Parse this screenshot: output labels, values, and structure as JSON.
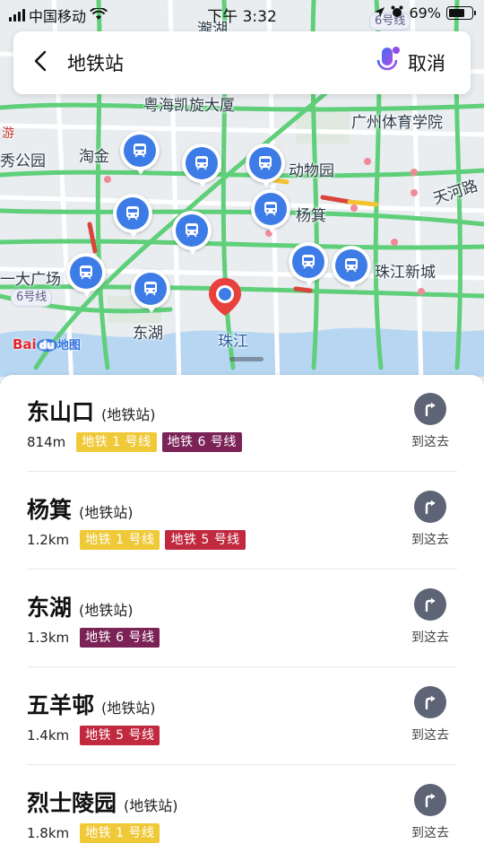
{
  "status_bar": {
    "carrier": "中国移动",
    "time": "下午 3:32",
    "battery": "69%",
    "battery_level": 0.69
  },
  "search": {
    "query": "地铁站",
    "cancel_label": "取消",
    "back_icon": "chevron-left-icon",
    "voice_icon": "microphone-icon"
  },
  "map": {
    "labels": {
      "shahe": "瀧湖",
      "yuehai": "粤海凯旋大厦",
      "sport_college": "广州体育学院",
      "taojin": "淘金",
      "zoo": "动物园",
      "tianhe_road": "天河路",
      "yangji": "杨箕",
      "zhujiang_newtown": "珠江新城",
      "yida_plaza": "一大广场",
      "donghu": "东湖",
      "zhujiang": "珠江",
      "xiu_park": "秀公园",
      "travel_tag": "游"
    },
    "line_tags": {
      "line6_top": "6号线",
      "line6_left": "6号线"
    },
    "logo": {
      "bai": "Bai",
      "du": "du",
      "map": "地图"
    },
    "colors": {
      "background": "#e9edf0",
      "road_major": "#5fcf7a",
      "road_minor": "#ffffff",
      "river": "#b7d6f2",
      "metro_pin": "#3d7be6",
      "location_pin": "#e8403a"
    }
  },
  "stations": [
    {
      "name": "东山口",
      "type": "(地铁站)",
      "distance": "814m",
      "lines": [
        {
          "label": "地铁 1 号线",
          "color": "#f0c938"
        },
        {
          "label": "地铁 6 号线",
          "color": "#7b2257"
        }
      ],
      "action": "到这去"
    },
    {
      "name": "杨箕",
      "type": "(地铁站)",
      "distance": "1.2km",
      "lines": [
        {
          "label": "地铁 1 号线",
          "color": "#f0c938"
        },
        {
          "label": "地铁 5 号线",
          "color": "#c1293f"
        }
      ],
      "action": "到这去"
    },
    {
      "name": "东湖",
      "type": "(地铁站)",
      "distance": "1.3km",
      "lines": [
        {
          "label": "地铁 6 号线",
          "color": "#7b2257"
        }
      ],
      "action": "到这去"
    },
    {
      "name": "五羊邨",
      "type": "(地铁站)",
      "distance": "1.4km",
      "lines": [
        {
          "label": "地铁 5 号线",
          "color": "#c1293f"
        }
      ],
      "action": "到这去"
    },
    {
      "name": "烈士陵园",
      "type": "(地铁站)",
      "distance": "1.8km",
      "lines": [
        {
          "label": "地铁 1 号线",
          "color": "#f0c938"
        }
      ],
      "action": "到这去"
    }
  ]
}
